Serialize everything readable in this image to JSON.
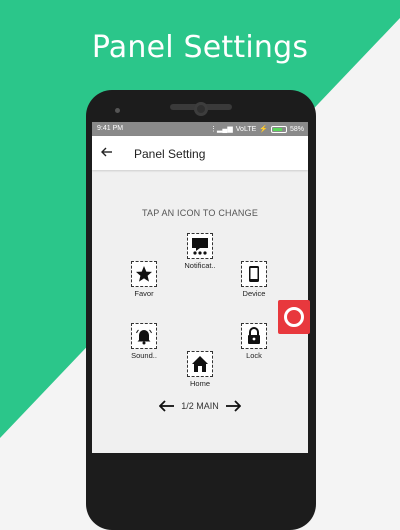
{
  "promo": {
    "title": "Panel Settings"
  },
  "colors": {
    "accent": "#2bc68a",
    "fab": "#e8383d",
    "screen_bg": "#f0f0f0"
  },
  "status_bar": {
    "time": "9:41 PM",
    "network": "VoLTE",
    "battery": "58%"
  },
  "app_bar": {
    "title": "Panel Setting",
    "back_icon": "arrow-left-icon"
  },
  "hint": "TAP AN ICON TO CHANGE",
  "panel_icons": [
    {
      "label": "Notificat..",
      "icon": "notification-icon"
    },
    {
      "label": "Device",
      "icon": "phone-icon"
    },
    {
      "label": "Lock",
      "icon": "lock-icon"
    },
    {
      "label": "Home",
      "icon": "home-icon"
    },
    {
      "label": "Sound..",
      "icon": "bell-icon"
    },
    {
      "label": "Favor",
      "icon": "star-icon"
    }
  ],
  "navigation": {
    "label": "1/2 MAIN",
    "prev_icon": "arrow-left-icon",
    "next_icon": "arrow-right-icon"
  },
  "floating_button": {
    "icon": "circle-icon"
  }
}
